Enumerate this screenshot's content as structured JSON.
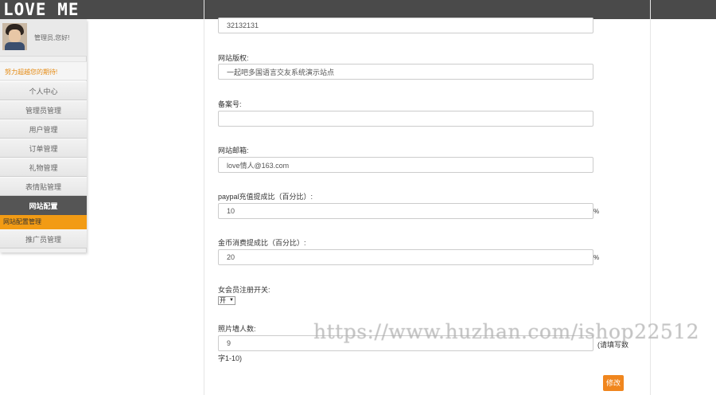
{
  "header": {
    "logo": "LOVE ME"
  },
  "sidebar": {
    "greeting": "管理员,您好!",
    "motto": "努力超越您的期待!",
    "menu": [
      {
        "label": "个人中心"
      },
      {
        "label": "管理员管理"
      },
      {
        "label": "用户管理"
      },
      {
        "label": "订单管理"
      },
      {
        "label": "礼物管理"
      },
      {
        "label": "表情贴管理"
      },
      {
        "label": "网站配置"
      }
    ],
    "submenu_label": "网站配置管理",
    "last_item": "推广员管理"
  },
  "form": {
    "first_value": "32132131",
    "copyright_label": "网站版权:",
    "copyright_value": "一起吧多国语言交友系统演示站点",
    "icp_label": "备案号:",
    "icp_value": "",
    "email_label": "网站邮箱:",
    "email_value": "love情人@163.com",
    "paypal_label": "paypal充值提成比（百分比）:",
    "paypal_value": "10",
    "coin_label": "金币消费提成比（百分比）:",
    "coin_value": "20",
    "percent_sign": "%",
    "female_label": "女会员注册开关:",
    "female_option": "开",
    "photo_label": "照片墙人数:",
    "photo_value": "9",
    "photo_hint_a": "(请填写数",
    "photo_hint_b": "字1-10)",
    "submit_label": "修改"
  },
  "watermark": "https://www.huzhan.com/ishop22512"
}
